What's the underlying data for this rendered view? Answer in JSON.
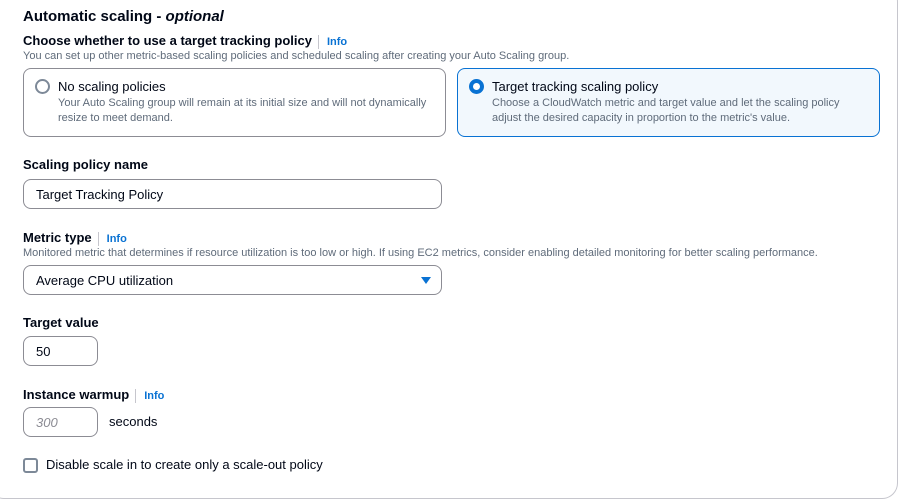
{
  "section": {
    "title": "Automatic scaling - ",
    "title_optional": "optional"
  },
  "tracking_choice": {
    "label": "Choose whether to use a target tracking policy",
    "info": "Info",
    "description": "You can set up other metric-based scaling policies and scheduled scaling after creating your Auto Scaling group.",
    "options": [
      {
        "title": "No scaling policies",
        "description": "Your Auto Scaling group will remain at its initial size and will not dynamically resize to meet demand.",
        "selected": false
      },
      {
        "title": "Target tracking scaling policy",
        "description": "Choose a CloudWatch metric and target value and let the scaling policy adjust the desired capacity in proportion to the metric's value.",
        "selected": true
      }
    ]
  },
  "policy_name": {
    "label": "Scaling policy name",
    "value": "Target Tracking Policy"
  },
  "metric_type": {
    "label": "Metric type",
    "info": "Info",
    "description": "Monitored metric that determines if resource utilization is too low or high. If using EC2 metrics, consider enabling detailed monitoring for better scaling performance.",
    "selected": "Average CPU utilization"
  },
  "target_value": {
    "label": "Target value",
    "value": "50"
  },
  "instance_warmup": {
    "label": "Instance warmup",
    "info": "Info",
    "placeholder": "300",
    "unit": "seconds"
  },
  "disable_scale_in": {
    "label": "Disable scale in to create only a scale-out policy",
    "checked": false
  },
  "colors": {
    "accent": "#0972d3",
    "text": "#000716",
    "muted": "#5f6b7a",
    "border": "#8c8c94",
    "selected_bg": "#f2f8fd"
  }
}
